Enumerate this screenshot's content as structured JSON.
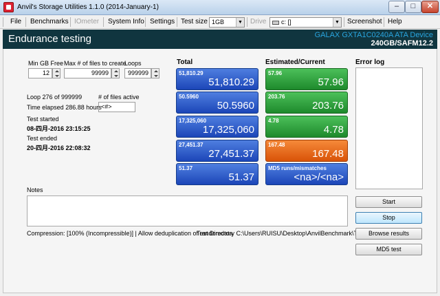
{
  "window": {
    "title": "Anvil's Storage Utilities 1.1.0 (2014-January-1)",
    "minimize_glyph": "–",
    "maximize_glyph": "□",
    "close_glyph": "✕"
  },
  "menu": {
    "file": "File",
    "benchmarks": "Benchmarks",
    "iometer": "IOmeter",
    "system_info": "System Info",
    "settings": "Settings",
    "test_size_label": "Test size",
    "test_size_value": "1GB",
    "drive_label": "Drive",
    "drive_value": "c: []",
    "screenshot": "Screenshot",
    "help": "Help"
  },
  "banner": {
    "title": "Endurance testing",
    "device_line1": "GALAX GXTA1C0240A ATA Device",
    "device_line2": "240GB/SAFM12.2"
  },
  "settings": {
    "min_gb_free_label": "Min GB Free",
    "min_gb_free_value": "12",
    "max_files_label": "Max # of files to create",
    "max_files_value": "99999",
    "loops_label": "Loops",
    "loops_value": "999999"
  },
  "status": {
    "loop_text": "Loop 276 of 999999",
    "files_active_label": "# of files active",
    "files_active_value": "<#>",
    "time_elapsed": "Time elapsed 286.88 hours",
    "test_started_label": "Test started",
    "test_started_value": "08-四月-2016 23:15:25",
    "test_ended_label": "Test ended",
    "test_ended_value": "20-四月-2016 22:08:32"
  },
  "columns": {
    "total": "Total",
    "estimated": "Estimated/Current",
    "error_log": "Error log",
    "notes": "Notes"
  },
  "total_tiles": [
    {
      "small": "51,810.29",
      "big": "51,810.29"
    },
    {
      "small": "50.5960",
      "big": "50.5960"
    },
    {
      "small": "17,325,060",
      "big": "17,325,060"
    },
    {
      "small": "27,451.37",
      "big": "27,451.37"
    },
    {
      "small": "51.37",
      "big": "51.37"
    }
  ],
  "estimated_tiles": [
    {
      "small": "57.96",
      "big": "57.96",
      "color": "green"
    },
    {
      "small": "203.76",
      "big": "203.76",
      "color": "green"
    },
    {
      "small": "4.78",
      "big": "4.78",
      "color": "green"
    },
    {
      "small": "167.48",
      "big": "167.48",
      "color": "orange"
    },
    {
      "small": "MD5 runs/mismatches",
      "big": "<na>/<na>",
      "color": "blue"
    }
  ],
  "footer": {
    "compression": "Compression: [100% (Incompressible)] | Allow deduplication of randomdata",
    "test_directory": "Test Directory C:\\Users\\RUISU\\Desktop\\AnvilBenchmark\\TEST"
  },
  "buttons": {
    "start": "Start",
    "stop": "Stop",
    "browse_results": "Browse results",
    "md5_test": "MD5 test"
  }
}
